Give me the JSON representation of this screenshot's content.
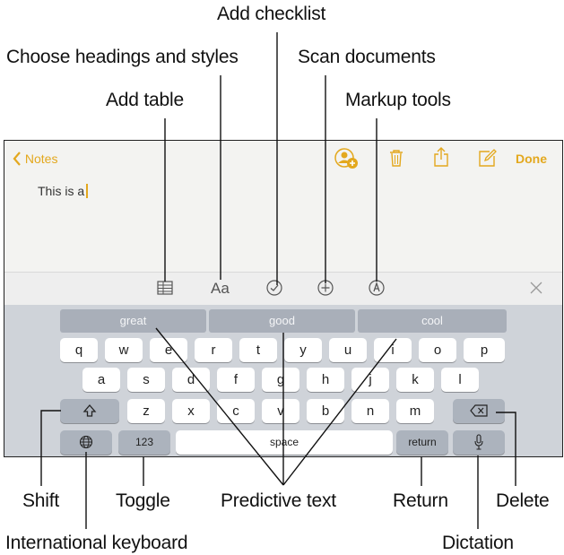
{
  "callouts": {
    "add_checklist": "Add checklist",
    "choose_headings": "Choose headings and styles",
    "scan_documents": "Scan documents",
    "add_table": "Add table",
    "markup_tools": "Markup tools",
    "shift": "Shift",
    "toggle": "Toggle",
    "predictive_text": "Predictive text",
    "return": "Return",
    "delete": "Delete",
    "international_keyboard": "International keyboard",
    "dictation": "Dictation"
  },
  "nav": {
    "back_label": "Notes",
    "done_label": "Done",
    "back_icon": "chevron-left-icon",
    "collaborate_icon": "add-person-icon",
    "trash_icon": "trash-icon",
    "share_icon": "share-icon",
    "compose_icon": "compose-icon"
  },
  "note": {
    "text": "This is a"
  },
  "format_bar": {
    "table_icon": "table-icon",
    "styles_label": "Aa",
    "checklist_icon": "checklist-icon",
    "plus_icon": "plus-circle-icon",
    "markup_icon": "markup-icon",
    "close_icon": "close-icon"
  },
  "predictions": [
    "great",
    "good",
    "cool"
  ],
  "keys": {
    "row1": [
      "q",
      "w",
      "e",
      "r",
      "t",
      "y",
      "u",
      "i",
      "o",
      "p"
    ],
    "row2": [
      "a",
      "s",
      "d",
      "f",
      "g",
      "h",
      "j",
      "k",
      "l"
    ],
    "row3": [
      "z",
      "x",
      "c",
      "v",
      "b",
      "n",
      "m"
    ],
    "numbers_label": "123",
    "space_label": "space",
    "return_label": "return"
  },
  "colors": {
    "accent": "#e3a81e",
    "keyboard_bg": "#cfd3d9",
    "prediction_bg": "#a9afb9"
  }
}
